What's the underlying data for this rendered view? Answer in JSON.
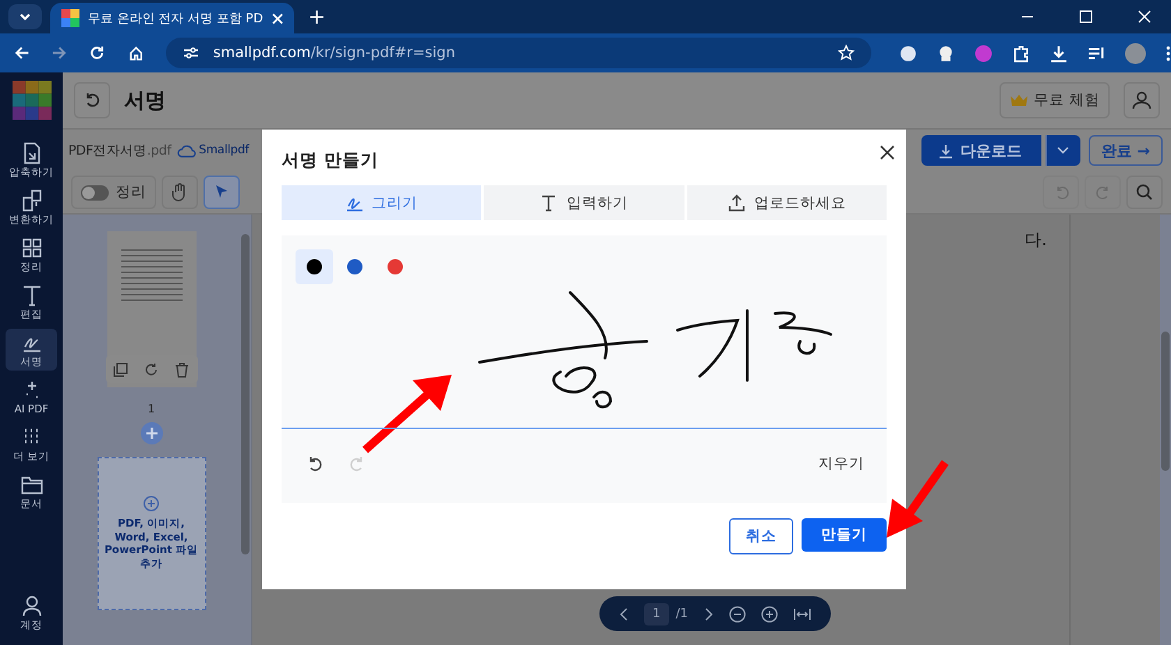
{
  "browser": {
    "tab_title": "무료 온라인 전자 서명 포함 PD",
    "new_tab": "+",
    "url_host": "smallpdf.com",
    "url_path": "/kr/sign-pdf#r=sign"
  },
  "header": {
    "title": "서명",
    "trial_button": "무료 체험"
  },
  "sidebar": {
    "items": [
      {
        "label": "압축하기",
        "kind": "compress",
        "selected": false
      },
      {
        "label": "변환하기",
        "kind": "convert",
        "selected": false
      },
      {
        "label": "정리",
        "kind": "organize",
        "selected": false
      },
      {
        "label": "편집",
        "kind": "edit",
        "selected": false
      },
      {
        "label": "서명",
        "kind": "sign",
        "selected": true
      },
      {
        "label": "AI PDF",
        "kind": "ai",
        "selected": false
      },
      {
        "label": "더 보기",
        "kind": "more",
        "selected": false
      },
      {
        "label": "문서",
        "kind": "folder",
        "selected": false
      }
    ],
    "account": "계정"
  },
  "file": {
    "name": "PDF전자서명",
    "ext": ".pdf",
    "cloud": "Smallpdf"
  },
  "toolbar": {
    "toggle": {
      "label": "정리",
      "on": false
    }
  },
  "actions": {
    "download": "다운로드",
    "done": "완료 →"
  },
  "thumbnails": {
    "page_number": "1",
    "drop_zone": "PDF, 이미지, Word, Excel, PowerPoint 파일 추가"
  },
  "document": {
    "text": "다."
  },
  "page_nav": {
    "page": "1",
    "total": "/1"
  },
  "modal": {
    "title": "서명 만들기",
    "tabs": [
      {
        "label": "그리기",
        "kind": "draw",
        "selected": true
      },
      {
        "label": "입력하기",
        "kind": "type",
        "selected": false
      },
      {
        "label": "업로드하세요",
        "kind": "upload",
        "selected": false
      }
    ],
    "pen_colors": [
      {
        "color": "#000000",
        "selected": true
      },
      {
        "color": "#1f5bc4",
        "selected": false
      },
      {
        "color": "#e53935",
        "selected": false
      }
    ],
    "redo_disabled": true,
    "clear": "지우기",
    "cancel": "취소",
    "create": "만들기"
  }
}
